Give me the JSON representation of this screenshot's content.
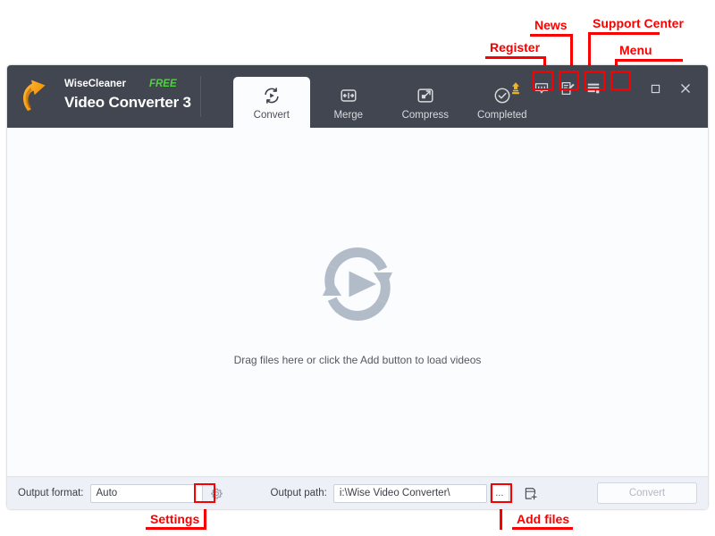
{
  "window": {
    "brand_name": "WiseCleaner",
    "brand_edition": "FREE",
    "product_title": "Video Converter 3"
  },
  "tabs": [
    {
      "label": "Convert",
      "icon": "convert-icon",
      "active": true
    },
    {
      "label": "Merge",
      "icon": "merge-icon",
      "active": false
    },
    {
      "label": "Compress",
      "icon": "compress-icon",
      "active": false
    },
    {
      "label": "Completed",
      "icon": "completed-icon",
      "active": false
    }
  ],
  "header_icons": [
    {
      "name": "register-icon",
      "title": "Register"
    },
    {
      "name": "news-icon",
      "title": "News"
    },
    {
      "name": "support-center-icon",
      "title": "Support Center"
    },
    {
      "name": "menu-icon",
      "title": "Menu"
    }
  ],
  "window_controls": {
    "minimize": "minimize-icon",
    "maximize": "maximize-icon",
    "close": "close-icon"
  },
  "workspace": {
    "drop_hint": "Drag files here or click the Add button to load videos",
    "graphic": "convert-placeholder-icon"
  },
  "bottom_bar": {
    "output_format_label": "Output format:",
    "output_format_value": "Auto",
    "settings_icon": "gear-icon",
    "output_path_label": "Output path:",
    "output_path_value": "i:\\Wise Video Converter\\",
    "browse_label": "...",
    "add_files_icon": "add-files-icon",
    "convert_label": "Convert"
  },
  "annotations": [
    {
      "id": "register",
      "label": "Register"
    },
    {
      "id": "news",
      "label": "News"
    },
    {
      "id": "support-center",
      "label": "Support Center"
    },
    {
      "id": "menu",
      "label": "Menu"
    },
    {
      "id": "settings",
      "label": "Settings"
    },
    {
      "id": "add-files",
      "label": "Add files"
    }
  ],
  "colors": {
    "titlebar": "#414651",
    "accent_free": "#4dd43c",
    "annotation": "#fa0000",
    "logo_orange": "#f5a623",
    "workspace": "#fbfcfe"
  }
}
